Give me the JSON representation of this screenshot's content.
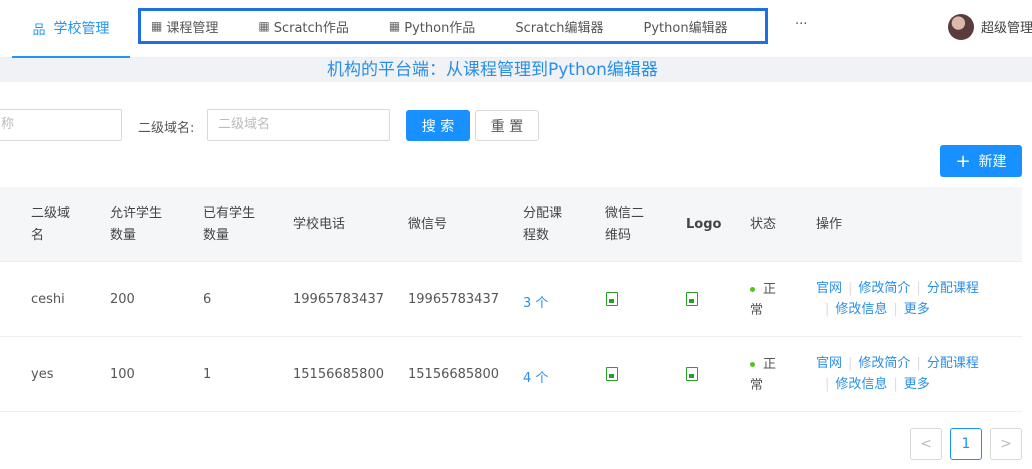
{
  "topbar": {
    "active_tab": {
      "label": "学校管理",
      "icon": "sitemap-icon"
    },
    "menu": [
      {
        "label": "课程管理",
        "icon": "grid-icon"
      },
      {
        "label": "Scratch作品",
        "icon": "grid-icon"
      },
      {
        "label": "Python作品",
        "icon": "grid-icon"
      },
      {
        "label": "Scratch编辑器",
        "icon": ""
      },
      {
        "label": "Python编辑器",
        "icon": ""
      }
    ],
    "more": "···",
    "user": "超级管理"
  },
  "banner": "机构的平台端：从课程管理到Python编辑器",
  "search": {
    "name_placeholder_partial": "称",
    "domain_label": "二级域名:",
    "domain_placeholder": "二级域名",
    "search_button": "搜 索",
    "reset_button": "重 置",
    "new_button": "新建"
  },
  "table": {
    "headers": {
      "domain": [
        "二级域",
        "名"
      ],
      "allowed": [
        "允许学生",
        "数量"
      ],
      "existing": [
        "已有学生",
        "数量"
      ],
      "phone": "学校电话",
      "wechat": "微信号",
      "courses": [
        "分配课",
        "程数"
      ],
      "qrcode": [
        "微信二",
        "维码"
      ],
      "logo": "Logo",
      "status": "状态",
      "actions": "操作"
    },
    "rows": [
      {
        "domain": "ceshi",
        "allowed": "200",
        "existing": "6",
        "phone": "19965783437",
        "wechat": "19965783437",
        "courses": "3 个",
        "status": [
          "正",
          "常"
        ],
        "actions": [
          "官网",
          "修改简介",
          "分配课程",
          "修改信息",
          "更多"
        ]
      },
      {
        "domain": "yes",
        "allowed": "100",
        "existing": "1",
        "phone": "15156685800",
        "wechat": "15156685800",
        "courses": "4 个",
        "status": [
          "正",
          "常"
        ],
        "actions": [
          "官网",
          "修改简介",
          "分配课程",
          "修改信息",
          "更多"
        ]
      }
    ]
  },
  "pager": {
    "prev": "<",
    "page": "1",
    "next": ">"
  },
  "colors": {
    "accent": "#1890ff",
    "highlight_box": "#1e6fe0",
    "status_ok": "#52c41a",
    "file_icon": "#27a025"
  }
}
